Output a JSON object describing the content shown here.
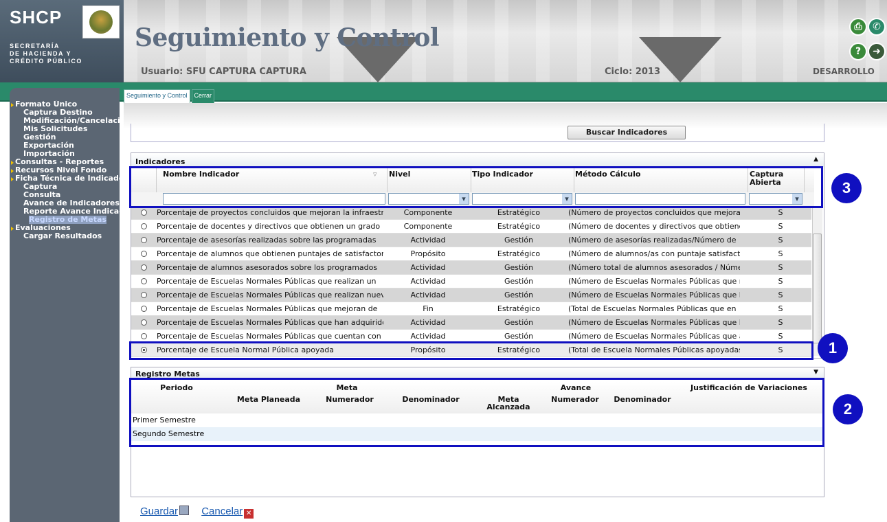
{
  "logo": {
    "name": "SHCP",
    "subtitle": "SECRETARÍA\nDE HACIENDA Y\nCRÉDITO PÚBLICO"
  },
  "header": {
    "title": "Seguimiento y Control",
    "user": "Usuario: SFU CAPTURA CAPTURA",
    "ciclo": "Ciclo: 2013",
    "env": "DESARROLLO"
  },
  "tabs": [
    "Seguimiento y Control",
    "Cerrar"
  ],
  "sidebar": [
    {
      "label": "Formato Único",
      "level": 1
    },
    {
      "label": "Captura Destino",
      "level": 2
    },
    {
      "label": "Modificación/Cancelación",
      "level": 2
    },
    {
      "label": "Mis Solicitudes",
      "level": 2
    },
    {
      "label": "Gestión",
      "level": 2
    },
    {
      "label": "Exportación",
      "level": 2
    },
    {
      "label": "Importación",
      "level": 2
    },
    {
      "label": "Consultas - Reportes",
      "level": 1
    },
    {
      "label": "Recursos Nivel Fondo",
      "level": 1
    },
    {
      "label": "Ficha Técnica de Indicadores",
      "level": 1
    },
    {
      "label": "Captura",
      "level": 2
    },
    {
      "label": "Consulta",
      "level": 2
    },
    {
      "label": "Avance de Indicadores",
      "level": 2
    },
    {
      "label": "Reporte Avance Indicadores",
      "level": 2
    },
    {
      "label": "Registro de Metas",
      "level": 3,
      "selected": true
    },
    {
      "label": "Evaluaciones",
      "level": 1
    },
    {
      "label": "Cargar Resultados",
      "level": 2
    }
  ],
  "search_button": "Buscar Indicadores",
  "indicadores": {
    "title": "Indicadores",
    "columns": [
      "Nombre Indicador",
      "Nivel",
      "Tipo Indicador",
      "Método Cálculo",
      "Captura Abierta"
    ],
    "rows": [
      [
        "Porcentaje de proyectos concluidos que mejoran la infraestructura",
        "Componente",
        "Estratégico",
        "(Número de proyectos concluidos que mejoran",
        "S"
      ],
      [
        "Porcentaje de docentes y directivos que obtienen un grado",
        "Componente",
        "Estratégico",
        "(Número de docentes y directivos que obtienen",
        "S"
      ],
      [
        "Porcentaje de asesorías realizadas sobre las programadas",
        "Actividad",
        "Gestión",
        "(Número de asesorías realizadas/Número de",
        "S"
      ],
      [
        "Porcentaje de alumnos que obtienen puntajes de satisfactorio",
        "Propósito",
        "Estratégico",
        "(Número de alumnos/as con puntaje satisfactorio",
        "S"
      ],
      [
        "Porcentaje de alumnos asesorados sobre los programados",
        "Actividad",
        "Gestión",
        "(Número total de alumnos asesorados / Número",
        "S"
      ],
      [
        "Porcentaje de Escuelas Normales Públicas que realizan un",
        "Actividad",
        "Gestión",
        "(Número de Escuelas Normales Públicas que r",
        "S"
      ],
      [
        "Porcentaje de Escuelas Normales Públicas que realizan nuevas",
        "Actividad",
        "Gestión",
        "(Número de Escuelas Normales Públicas que l",
        "S"
      ],
      [
        "Porcentaje de Escuelas Normales Públicas que mejoran de",
        "Fin",
        "Estratégico",
        "(Total de Escuelas Normales Públicas que en",
        "S"
      ],
      [
        "Porcentaje de Escuelas Normales Públicas que han adquirido",
        "Actividad",
        "Gestión",
        "(Número de Escuelas Normales Públicas que l",
        "S"
      ],
      [
        "Porcentaje de Escuelas Normales Públicas que cuentan con",
        "Actividad",
        "Gestión",
        "(Número de Escuelas Normales Públicas que a",
        "S"
      ],
      [
        "Porcentaje de Escuela Normal Pública apoyada",
        "Propósito",
        "Estratégico",
        "(Total de Escuela Normales Públicas apoyadas",
        "S"
      ]
    ],
    "selected_row": 10
  },
  "registro": {
    "title": "Registro Metas",
    "periodo": "Periodo",
    "meta": "Meta",
    "avance": "Avance",
    "justificacion": "Justificación de Variaciones",
    "meta_planeada": "Meta Planeada",
    "numerador": "Numerador",
    "denominador": "Denominador",
    "meta_alcanzada": "Meta Alcanzada",
    "numerador2": "Numerador",
    "denominador2": "Denominador",
    "rows": [
      "Primer Semestre",
      "Segundo Semestre"
    ]
  },
  "callouts": [
    "1",
    "2",
    "3"
  ],
  "actions": {
    "save": "Guardar",
    "cancel": "Cancelar"
  },
  "colors": {
    "accent": "#2a8a6a",
    "highlight": "#1010c0",
    "sidebar": "#5b6673"
  }
}
